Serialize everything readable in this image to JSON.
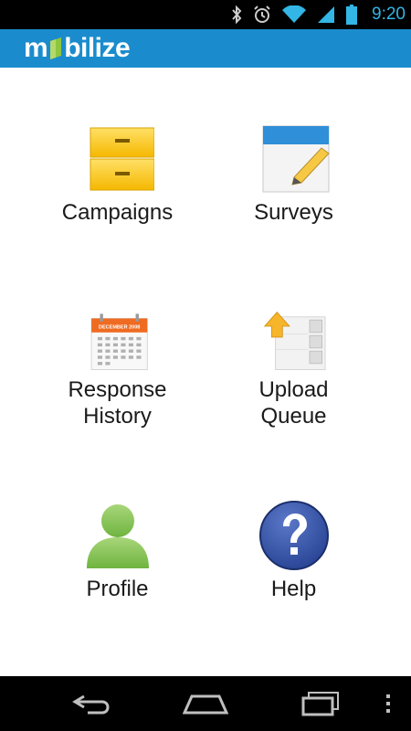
{
  "status_bar": {
    "time": "9:20",
    "icons": [
      "bluetooth-icon",
      "alarm-icon",
      "wifi-icon",
      "signal-icon",
      "battery-icon"
    ],
    "accent_color": "#33b5e5"
  },
  "app_bar": {
    "logo_prefix": "m",
    "logo_suffix": "bilize",
    "background_color": "#1a8ccd"
  },
  "menu": {
    "items": [
      {
        "label": "Campaigns",
        "icon": "drawer-icon"
      },
      {
        "label": "Surveys",
        "icon": "notepad-pencil-icon"
      },
      {
        "label": "Response\nHistory",
        "icon": "calendar-icon",
        "calendar_header": "DECEMBER 2008"
      },
      {
        "label": "Upload\nQueue",
        "icon": "upload-list-icon"
      },
      {
        "label": "Profile",
        "icon": "person-icon"
      },
      {
        "label": "Help",
        "icon": "question-icon"
      }
    ]
  },
  "nav_bar": {
    "buttons": [
      "back-icon",
      "home-icon",
      "recent-apps-icon",
      "overflow-menu-icon"
    ]
  }
}
